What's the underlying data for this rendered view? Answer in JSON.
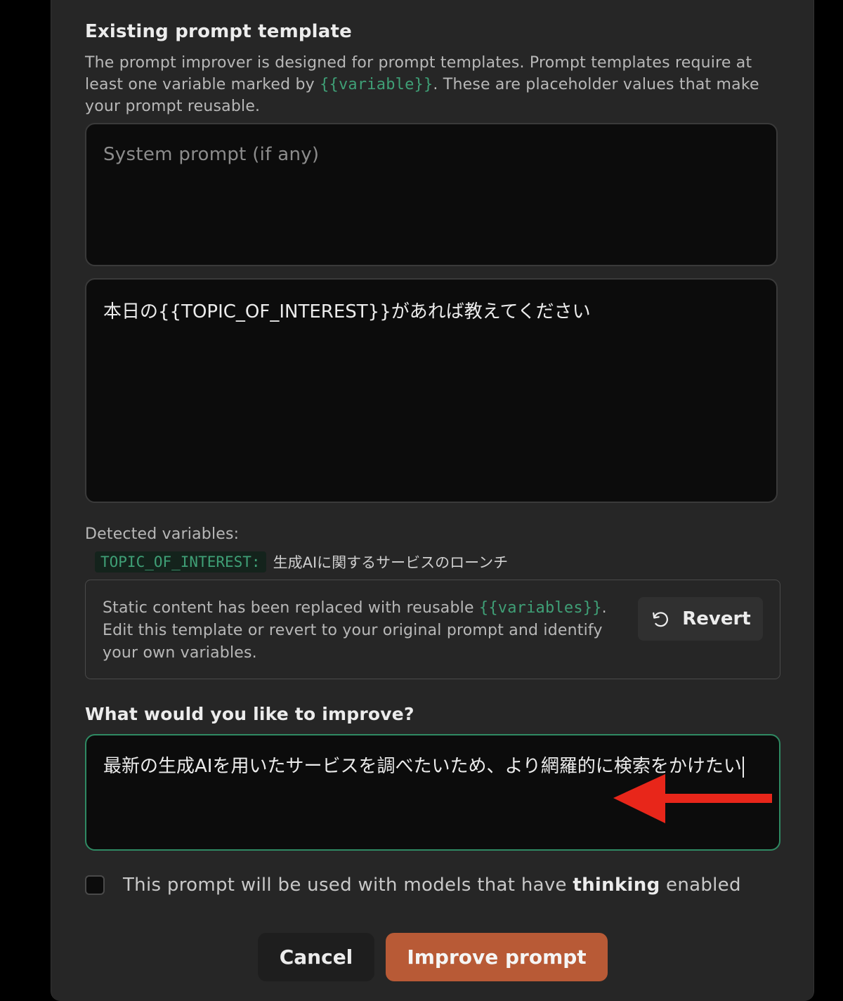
{
  "template_section": {
    "title": "Existing prompt template",
    "description_before": "The prompt improver is designed for prompt templates. Prompt templates require at least one variable marked by ",
    "description_code": "{{variable}}",
    "description_after": ". These are placeholder values that make your prompt reusable."
  },
  "system_prompt": {
    "placeholder": "System prompt (if any)",
    "value": ""
  },
  "user_prompt": {
    "value": "本日の{{TOPIC_OF_INTEREST}}があれば教えてください"
  },
  "detected_variables": {
    "label": "Detected variables:",
    "items": [
      {
        "name": "TOPIC_OF_INTEREST:",
        "value": "生成AIに関するサービスのローンチ"
      }
    ]
  },
  "notice": {
    "text_before": "Static content has been replaced with reusable ",
    "code": "{{variables}}",
    "text_after": ". Edit this template or revert to your original prompt and identify your own variables.",
    "revert_label": "Revert"
  },
  "improve_section": {
    "title": "What would you like to improve?",
    "value": "最新の生成AIを用いたサービスを調べたいため、より網羅的に検索をかけたい"
  },
  "thinking_checkbox": {
    "label_before": "This prompt will be used with models that have ",
    "label_bold": "thinking",
    "label_after": " enabled",
    "checked": false
  },
  "buttons": {
    "cancel": "Cancel",
    "improve": "Improve prompt"
  },
  "colors": {
    "accent_green": "#3f9f76",
    "improve_button": "#b85a36",
    "annotation_arrow": "#e8261a"
  }
}
